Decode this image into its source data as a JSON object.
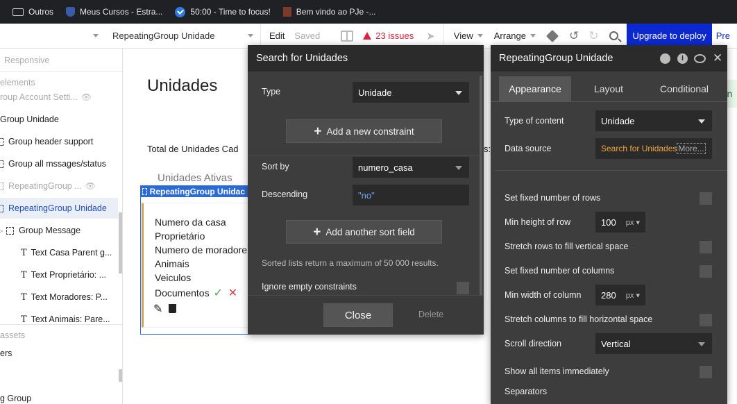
{
  "bookmarks": [
    {
      "label": "Outros",
      "icon": "folder-icon"
    },
    {
      "label": "Meus Cursos - Estra...",
      "icon": "shield-icon"
    },
    {
      "label": "50:00 - Time to focus!",
      "icon": "check-circle-icon"
    },
    {
      "label": "Bem vindo ao PJe -...",
      "icon": "pje-icon"
    }
  ],
  "toolbar": {
    "element_select": "RepeatingGroup Unidade",
    "edit": "Edit",
    "saved": "Saved",
    "issues": "23 issues",
    "view": "View",
    "arrange": "Arrange",
    "upgrade": "Upgrade to deploy",
    "preview": "Pre"
  },
  "left_panel": {
    "responsive": "Responsive",
    "elements": "elements",
    "items": [
      "roup Account Setti...",
      "Group Unidade",
      "Group header support",
      "Group all mssages/status",
      "RepeatingGroup ...",
      "RepeatingGroup Unidade",
      "Group Message",
      "Text Casa Parent g...",
      "Text Proprietário: ...",
      "Text Moradores: P...",
      "Text Animais: Pare..."
    ],
    "assets": "assets",
    "ers": "ers",
    "bottom": "g Group"
  },
  "canvas": {
    "title": "Unidades",
    "total_label": "Total de Unidades Cad",
    "total_suffix": "s:",
    "ativas": "Unidades Ativas",
    "rg_tag": "RepeatingGroup Unidac",
    "card_lines": [
      "Numero da casa",
      "Proprietário",
      "Numero de moradore",
      "Animais",
      "Veiculos",
      "Documentos"
    ],
    "right_stub": "r n"
  },
  "search_dialog": {
    "title": "Search for Unidades",
    "type_label": "Type",
    "type_value": "Unidade",
    "add_constraint": "Add a new constraint",
    "sort_by_label": "Sort by",
    "sort_by_value": "numero_casa",
    "descending_label": "Descending",
    "descending_value": "\"no\"",
    "add_sort": "Add another sort field",
    "note": "Sorted lists return a maximum of 50 000 results.",
    "ignore_label": "Ignore empty constraints",
    "close": "Close",
    "delete": "Delete"
  },
  "prop_editor": {
    "title": "RepeatingGroup Unidade",
    "tabs": [
      "Appearance",
      "Layout",
      "Conditional"
    ],
    "type_of_content_label": "Type of content",
    "type_of_content_value": "Unidade",
    "data_source_label": "Data source",
    "data_source_value": "Search for Unidades",
    "more": "More...",
    "fixed_rows": "Set fixed number of rows",
    "min_height_label": "Min height of row",
    "min_height_value": "100",
    "unit": "px",
    "stretch_rows": "Stretch rows to fill vertical space",
    "fixed_columns": "Set fixed number of columns",
    "min_width_label": "Min width of column",
    "min_width_value": "280",
    "stretch_columns": "Stretch columns to fill horizontal space",
    "scroll_label": "Scroll direction",
    "scroll_value": "Vertical",
    "show_all": "Show all items immediately",
    "separators": "Separators"
  },
  "colors": {
    "accent_blue": "#0c29d0",
    "issue_red": "#e0213b",
    "data_source_orange": "#f0a43a",
    "selection_blue": "#2a6bd8",
    "check_green": "#44b05a",
    "cross_red": "#e23c3c"
  }
}
